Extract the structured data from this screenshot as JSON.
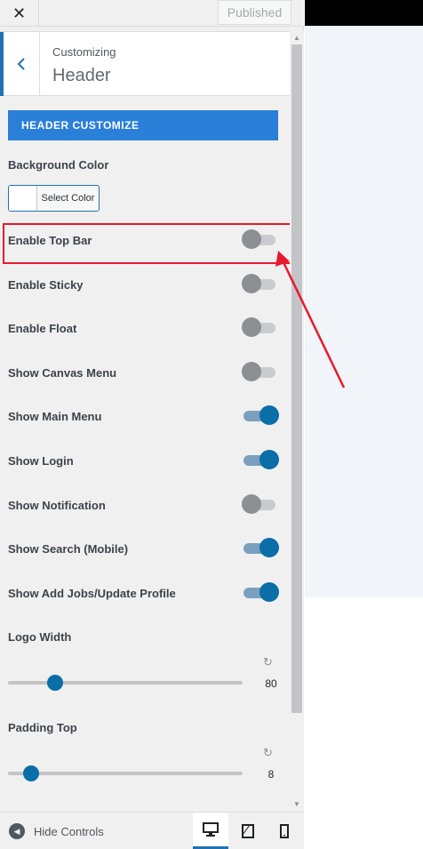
{
  "topbar": {
    "close_icon": "✕",
    "published_label": "Published"
  },
  "panel": {
    "back_icon": "‹",
    "subtitle": "Customizing",
    "title": "Header"
  },
  "section": {
    "title": "HEADER CUSTOMIZE"
  },
  "background_color": {
    "label": "Background Color",
    "button_label": "Select Color"
  },
  "toggles": [
    {
      "label": "Enable Top Bar",
      "on": false
    },
    {
      "label": "Enable Sticky",
      "on": false
    },
    {
      "label": "Enable Float",
      "on": false
    },
    {
      "label": "Show Canvas Menu",
      "on": false
    },
    {
      "label": "Show Main Menu",
      "on": true
    },
    {
      "label": "Show Login",
      "on": true
    },
    {
      "label": "Show Notification",
      "on": false
    },
    {
      "label": "Show Search (Mobile)",
      "on": true
    },
    {
      "label": "Show Add Jobs/Update Profile",
      "on": true
    }
  ],
  "logo_width": {
    "label": "Logo Width",
    "value": "80",
    "fraction": 0.18,
    "reset_icon": "↻"
  },
  "padding_top": {
    "label": "Padding Top",
    "value": "8",
    "fraction": 0.07,
    "reset_icon": "↻"
  },
  "footer": {
    "hide_label": "Hide Controls",
    "devices": [
      "desktop-icon",
      "tablet-icon",
      "mobile-icon"
    ],
    "active_device": "desktop"
  },
  "colors": {
    "accent": "#2271b1",
    "section_bg": "#2a7fd8",
    "toggle_on": "#0a6ea8",
    "highlight": "#e8192c"
  }
}
